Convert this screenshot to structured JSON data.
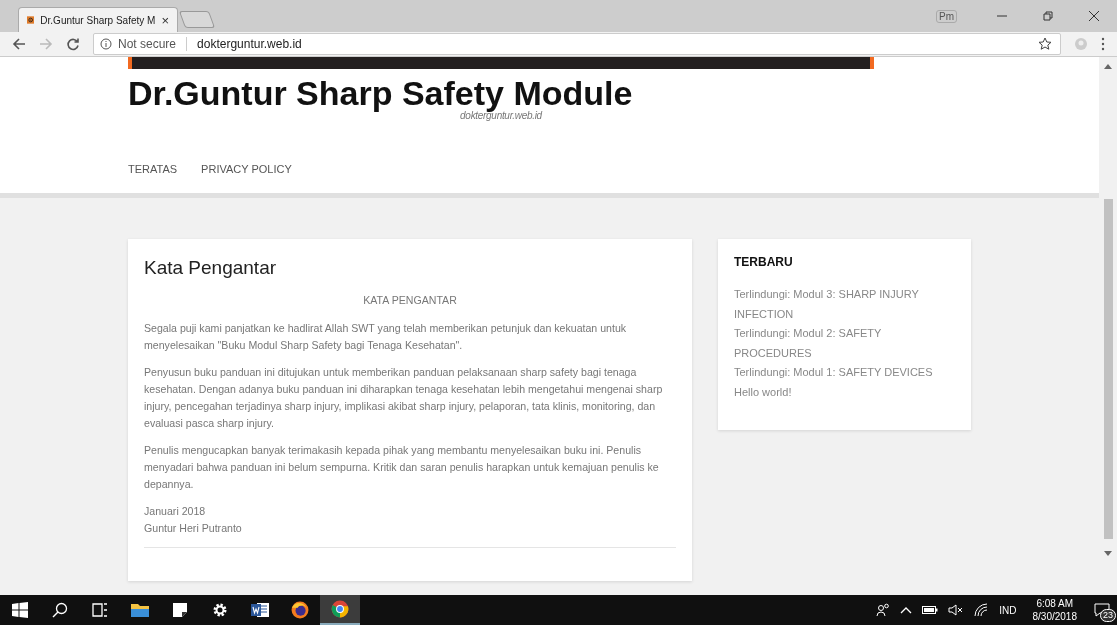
{
  "browser": {
    "tabs": [
      {
        "title": "Dr.Guntur Sharp Safety M",
        "close": "×",
        "selected": true
      }
    ],
    "ime": "Pm",
    "security": "Not secure",
    "url": "dokterguntur.web.id"
  },
  "site": {
    "title": "Dr.Guntur Sharp Safety Module",
    "tagline": "dokterguntur.web.id",
    "nav": [
      {
        "label": "TERATAS"
      },
      {
        "label": "PRIVACY POLICY"
      }
    ]
  },
  "article": {
    "title": "Kata Pengantar",
    "heading": "KATA PENGANTAR",
    "paragraphs": [
      "Segala puji kami panjatkan ke hadlirat Allah SWT yang telah memberikan petunjuk dan kekuatan untuk menyelesaikan \"Buku Modul Sharp Safety bagi Tenaga Kesehatan\".",
      "Penyusun buku panduan ini ditujukan untuk memberikan panduan pelaksanaan sharp safety bagi tenaga kesehatan. Dengan adanya buku panduan ini diharapkan tenaga kesehatan lebih mengetahui mengenai sharp injury, pencegahan terjadinya sharp injury, implikasi akibat sharp injury, pelaporan, tata klinis, monitoring, dan evaluasi pasca sharp injury.",
      "Penulis mengucapkan banyak terimakasih kepada pihak yang membantu menyelesaikan buku ini. Penulis menyadari bahwa panduan ini belum sempurna. Kritik dan saran penulis harapkan untuk kemajuan penulis ke depannya."
    ],
    "signature": [
      "Januari 2018",
      "Guntur Heri Putranto"
    ]
  },
  "sidebar": {
    "title": "TERBARU",
    "links": [
      "Terlindungi: Modul 3: SHARP INJURY INFECTION",
      "Terlindungi: Modul 2: SAFETY PROCEDURES",
      "Terlindungi: Modul 1: SAFETY DEVICES",
      "Hello world!"
    ]
  },
  "taskbar": {
    "apps": [
      {
        "kind": "start",
        "selected": false
      },
      {
        "kind": "search",
        "selected": false
      },
      {
        "kind": "taskview",
        "selected": false
      },
      {
        "kind": "folder",
        "selected": false
      },
      {
        "kind": "notes",
        "selected": false
      },
      {
        "kind": "settings",
        "selected": false
      },
      {
        "kind": "word",
        "selected": false
      },
      {
        "kind": "firefox",
        "selected": false
      },
      {
        "kind": "chrome",
        "selected": true
      }
    ],
    "language": "IND",
    "time": "6:08 AM",
    "date": "8/30/2018",
    "notifications": "23"
  }
}
